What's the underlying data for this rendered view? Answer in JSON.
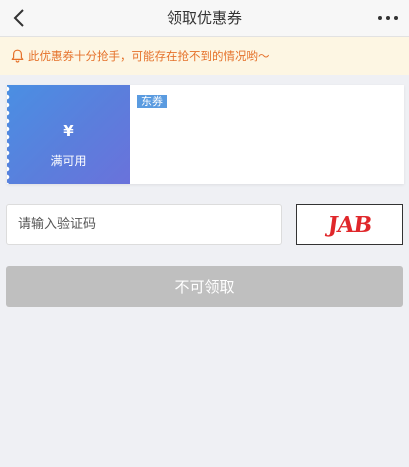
{
  "header": {
    "title": "领取优惠券",
    "back_icon": "chevron-left-icon",
    "more_icon": "more-dots-icon"
  },
  "notice": {
    "icon": "bell-icon",
    "text": "此优惠券十分抢手，可能存在抢不到的情况哟～"
  },
  "coupon": {
    "currency_symbol": "¥",
    "condition": "满可用",
    "tag": "东券"
  },
  "form": {
    "code_placeholder": "请输入验证码",
    "code_value": "",
    "captcha_text": "JAB",
    "claim_label": "不可领取"
  },
  "colors": {
    "notice_text": "#e5712a",
    "coupon_gradient_start": "#4a8fe3",
    "coupon_gradient_end": "#6a72db",
    "disabled_button": "#bfbfbf",
    "captcha": "#e0272b"
  }
}
